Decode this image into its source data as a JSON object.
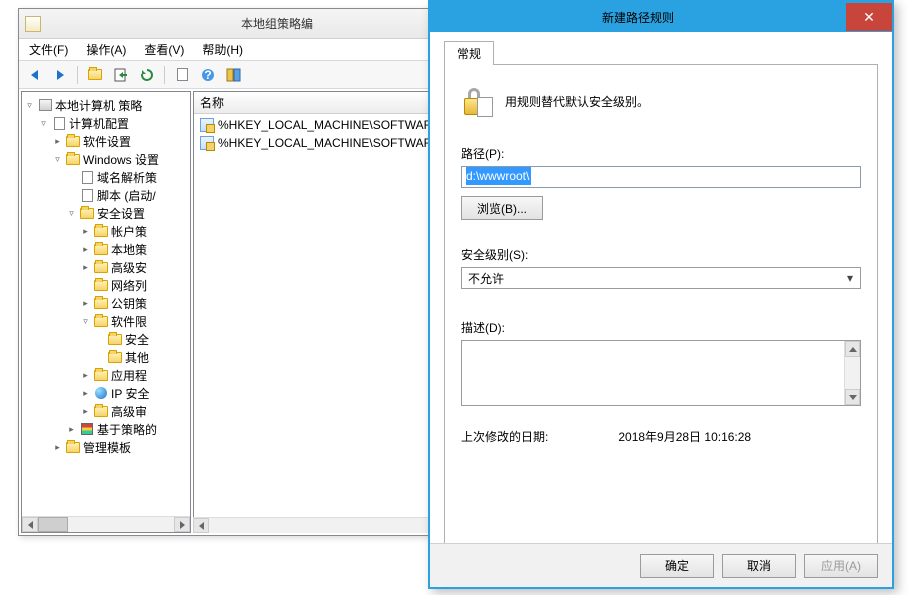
{
  "mmc": {
    "title": "本地组策略编",
    "menu": {
      "file": "文件(F)",
      "action": "操作(A)",
      "view": "查看(V)",
      "help": "帮助(H)"
    },
    "list": {
      "header_name": "名称",
      "rows": [
        "%HKEY_LOCAL_MACHINE\\SOFTWAR",
        "%HKEY_LOCAL_MACHINE\\SOFTWAR"
      ]
    },
    "tree": [
      {
        "indent": 0,
        "toggle": "▿",
        "icon": "book",
        "label": "本地计算机 策略"
      },
      {
        "indent": 1,
        "toggle": "▿",
        "icon": "doc",
        "label": "计算机配置"
      },
      {
        "indent": 2,
        "toggle": "▸",
        "icon": "folder",
        "label": "软件设置"
      },
      {
        "indent": 2,
        "toggle": "▿",
        "icon": "folder",
        "label": "Windows 设置"
      },
      {
        "indent": 3,
        "toggle": "",
        "icon": "doc",
        "label": "域名解析策"
      },
      {
        "indent": 3,
        "toggle": "",
        "icon": "doc",
        "label": "脚本 (启动/"
      },
      {
        "indent": 3,
        "toggle": "▿",
        "icon": "folder",
        "label": "安全设置"
      },
      {
        "indent": 4,
        "toggle": "▸",
        "icon": "folder",
        "label": "帐户策"
      },
      {
        "indent": 4,
        "toggle": "▸",
        "icon": "folder",
        "label": "本地策"
      },
      {
        "indent": 4,
        "toggle": "▸",
        "icon": "folder",
        "label": "高级安"
      },
      {
        "indent": 4,
        "toggle": "",
        "icon": "folder",
        "label": "网络列"
      },
      {
        "indent": 4,
        "toggle": "▸",
        "icon": "folder",
        "label": "公钥策"
      },
      {
        "indent": 4,
        "toggle": "▿",
        "icon": "folder",
        "label": "软件限"
      },
      {
        "indent": 5,
        "toggle": "",
        "icon": "folder",
        "label": "安全"
      },
      {
        "indent": 5,
        "toggle": "",
        "icon": "folder",
        "label": "其他"
      },
      {
        "indent": 4,
        "toggle": "▸",
        "icon": "folder",
        "label": "应用程"
      },
      {
        "indent": 4,
        "toggle": "▸",
        "icon": "globe",
        "label": "IP 安全"
      },
      {
        "indent": 4,
        "toggle": "▸",
        "icon": "folder",
        "label": "高级审"
      },
      {
        "indent": 3,
        "toggle": "▸",
        "icon": "chart",
        "label": "基于策略的"
      },
      {
        "indent": 2,
        "toggle": "▸",
        "icon": "folder",
        "label": "管理模板"
      }
    ]
  },
  "dialog": {
    "title": "新建路径规则",
    "tab": "常规",
    "intro": "用规则替代默认安全级别。",
    "path_label": "路径(P):",
    "path_value": "d:\\wwwroot\\",
    "browse_btn": "浏览(B)...",
    "sec_label": "安全级别(S):",
    "sec_value": "不允许",
    "desc_label": "描述(D):",
    "modified_label": "上次修改的日期:",
    "modified_value": "2018年9月28日   10:16:28",
    "ok": "确定",
    "cancel": "取消",
    "apply": "应用(A)"
  }
}
